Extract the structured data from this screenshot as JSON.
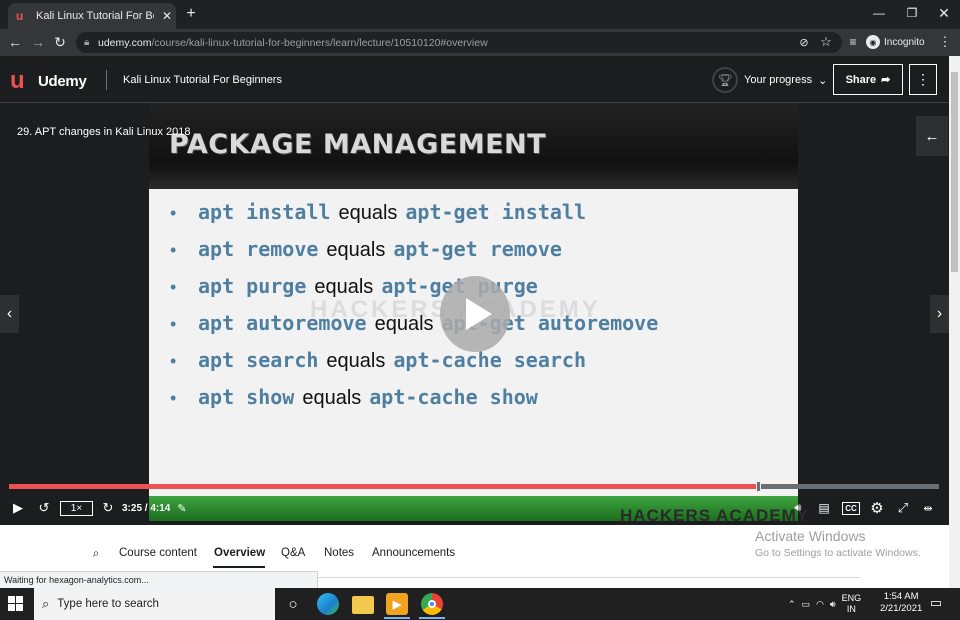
{
  "browser": {
    "tab_title": "Kali Linux Tutorial For Beginners",
    "tab_favicon": "udemy-favicon",
    "url_domain": "udemy.com",
    "url_path": "/course/kali-linux-tutorial-for-beginners/learn/lecture/10510120#overview",
    "incognito_label": "Incognito",
    "status_text": "Waiting for hexagon-analytics.com..."
  },
  "header": {
    "logo_text": "Udemy",
    "course_title": "Kali Linux Tutorial For Beginners",
    "progress_label": "Your progress",
    "share_label": "Share"
  },
  "player": {
    "lecture_title": "29. APT changes in Kali Linux 2018",
    "slide_heading": "PACKAGE MANAGEMENT",
    "watermark": "HACKERS ACADEMY",
    "bottom_watermark": "HACKERS ACADEMY",
    "slide_lines": [
      {
        "cmd": "apt install",
        "eq": "equals",
        "alt": "apt-get install"
      },
      {
        "cmd": "apt remove",
        "eq": "equals",
        "alt": "apt-get remove"
      },
      {
        "cmd": "apt purge",
        "eq": "equals",
        "alt": "apt-get purge"
      },
      {
        "cmd": "apt autoremove",
        "eq": "equals",
        "alt": "apt-get autoremove"
      },
      {
        "cmd": "apt search",
        "eq": "equals",
        "alt": "apt-cache search"
      },
      {
        "cmd": "apt show",
        "eq": "equals",
        "alt": "apt-cache show"
      }
    ],
    "speed": "1×",
    "time": "3:25 / 4:14",
    "progress_fraction": 0.806
  },
  "tabs": [
    "Course content",
    "Overview",
    "Q&A",
    "Notes",
    "Announcements"
  ],
  "activate_windows": {
    "title": "Activate Windows",
    "subtitle": "Go to Settings to activate Windows."
  },
  "taskbar": {
    "search_placeholder": "Type here to search",
    "lang_top": "ENG",
    "lang_bottom": "IN",
    "time": "1:54 AM",
    "date": "2/21/2021"
  },
  "colors": {
    "brand": "#ec5252",
    "slide_code": "#4e7fa1",
    "header_bg": "#1c1d1f"
  }
}
